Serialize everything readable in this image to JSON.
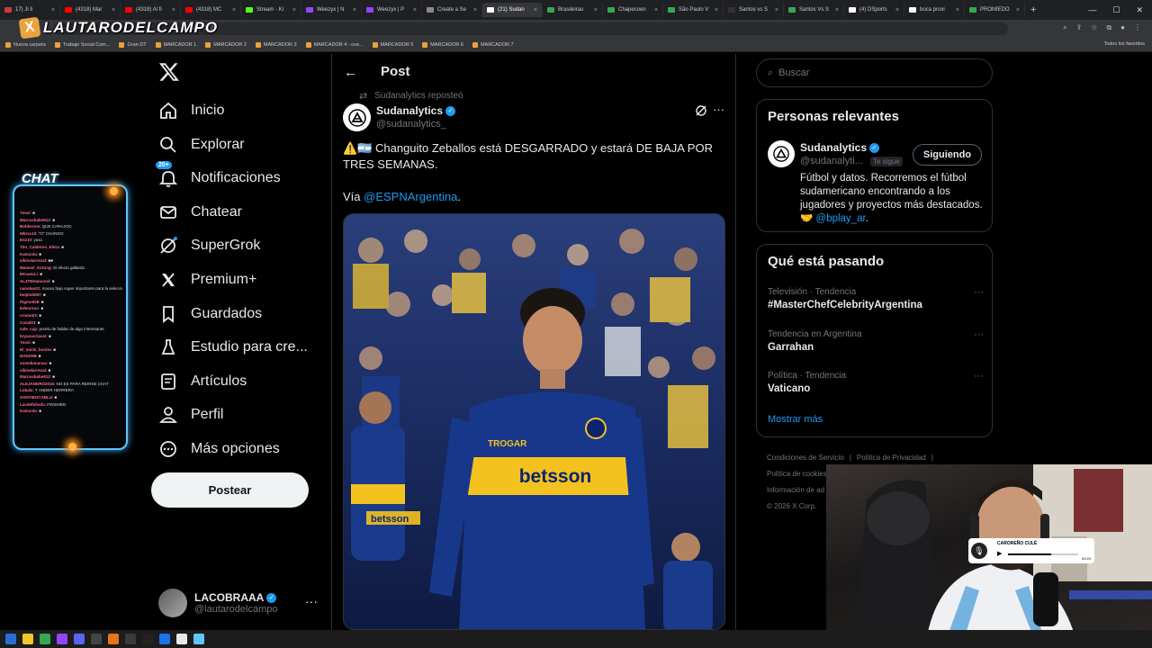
{
  "browser": {
    "tabs": [
      {
        "title": "17) Ji li",
        "color": "#c83c3c"
      },
      {
        "title": "(4318) Mar",
        "color": "#ff0000"
      },
      {
        "title": "(4318) Al fi",
        "color": "#ff0000"
      },
      {
        "title": "(4318) MC",
        "color": "#ff0000"
      },
      {
        "title": "Stream - Ki",
        "color": "#53fc18"
      },
      {
        "title": "Weezyx | N",
        "color": "#9146ff"
      },
      {
        "title": "Weezyx | P",
        "color": "#9146ff"
      },
      {
        "title": "Create a Se",
        "color": "#888888"
      },
      {
        "title": "(21) Sudan",
        "color": "#ffffff",
        "active": true
      },
      {
        "title": "Brasileirao",
        "color": "#34a853"
      },
      {
        "title": "Chapecoen",
        "color": "#34a853"
      },
      {
        "title": "São Paulo V",
        "color": "#34a853"
      },
      {
        "title": "Santos vs S",
        "color": "#333333"
      },
      {
        "title": "Santos Vs S",
        "color": "#34a853"
      },
      {
        "title": "(4) DSports",
        "color": "#ffffff"
      },
      {
        "title": "boca proxi",
        "color": "#ffffff"
      },
      {
        "title": "PROMIEDO",
        "color": "#34a853"
      }
    ],
    "new_tab": "+",
    "window_controls": [
      "—",
      "☐",
      "✕"
    ],
    "address_fragment": "2973672",
    "bookmarks": [
      "Nueva carpeta",
      "Trabajo Social Com...",
      "Gran DT",
      "MARCADOR 1",
      "MARCADOR 2",
      "MARCADOR 3",
      "MARCADOR 4 - ove...",
      "MARCADOR 5",
      "MARCADOR 6",
      "MARCADOR 7"
    ],
    "all_bookmarks": "Todos los favoritos"
  },
  "overlay": {
    "streamer_logo": "LAUTARODELCAMPO",
    "chat_title": "CHAT",
    "chat_lines": [
      {
        "user": "Yossi",
        "msg": ": ■"
      },
      {
        "user": "Marcosbabe912",
        "msg": ": ■"
      },
      {
        "user": "Bolderone",
        "msg": ": QUE CARAJOO"
      },
      {
        "user": "Mbrxc10",
        "msg": ": \"O\" CHANGO"
      },
      {
        "user": "Enz10",
        "msg": ": yoso"
      },
      {
        "user": "Tito_Calderon_Elera",
        "msg": ": ■"
      },
      {
        "user": "Kamcola",
        "msg": ": ■"
      },
      {
        "user": "vikinelarrenal",
        "msg": ": ■■"
      },
      {
        "user": "Mamsel_013ong",
        "msg": ": El efecto gallardo"
      },
      {
        "user": "EKnatoLi",
        "msg": ": ■"
      },
      {
        "user": "AL4TEHamonel",
        "msg": ": ■"
      },
      {
        "user": "nanolao01",
        "msg": ": mooso bajo super importante para la seleccion cabro"
      },
      {
        "user": "beqito0097",
        "msg": ": ■"
      },
      {
        "user": "Pigmo028",
        "msg": ": ■"
      },
      {
        "user": "Edenrnoo",
        "msg": ": ■"
      },
      {
        "user": "cromo03",
        "msg": ": ■"
      },
      {
        "user": "Canal03",
        "msg": ": ■"
      },
      {
        "user": "sale_cap",
        "msg": ": porelo de hablar de algo interesante"
      },
      {
        "user": "bryanuvriaset",
        "msg": ": ■"
      },
      {
        "user": "Yossi",
        "msg": ": ■"
      },
      {
        "user": "El_michi_bonito",
        "msg": ": ■"
      },
      {
        "user": "NANO98",
        "msg": ": ■"
      },
      {
        "user": "somebananas",
        "msg": ": ■"
      },
      {
        "user": "vikinelarrenal",
        "msg": ": ■"
      },
      {
        "user": "Marcosbabe912",
        "msg": ": ■"
      },
      {
        "user": "ALEJANDRO2015",
        "msg": ": NO ES PARA REIRSE CHAT"
      },
      {
        "user": "Lobalx",
        "msg": ": Y ANDER HERRERA"
      },
      {
        "user": "SANTIBOCABLU",
        "msg": ": ■"
      },
      {
        "user": "Lacdefuhsda",
        "msg": ": FINISHED"
      },
      {
        "user": "Kamcola",
        "msg": ": ■"
      }
    ],
    "music_title": "CAROREÑO CULÉ",
    "music_progress": 0.62,
    "music_time": "00:20"
  },
  "nav": {
    "items": [
      {
        "label": "Inicio",
        "icon": "home-icon"
      },
      {
        "label": "Explorar",
        "icon": "search-icon"
      },
      {
        "label": "Notificaciones",
        "icon": "bell-icon",
        "badge": "20+"
      },
      {
        "label": "Chatear",
        "icon": "mail-icon"
      },
      {
        "label": "SuperGrok",
        "icon": "grok-icon"
      },
      {
        "label": "Premium+",
        "icon": "x-premium-icon"
      },
      {
        "label": "Guardados",
        "icon": "bookmark-icon"
      },
      {
        "label": "Estudio para cre...",
        "icon": "flask-icon"
      },
      {
        "label": "Artículos",
        "icon": "article-icon"
      },
      {
        "label": "Perfil",
        "icon": "person-icon"
      },
      {
        "label": "Más opciones",
        "icon": "more-circle-icon"
      }
    ],
    "post_button": "Postear",
    "account": {
      "name": "LACOBRAAA",
      "handle": "@lautarodelcampo"
    }
  },
  "post": {
    "header": "Post",
    "reposted_by": "Sudanalytics reposteó",
    "author_name": "Sudanalytics",
    "author_handle": "@sudanalytics_",
    "text": "⚠️🇦🇷 Changuito Zeballos está DESGARRADO y estará DE BAJA POR TRES SEMANAS.",
    "via_prefix": "Vía ",
    "via_link": "@ESPNArgentina",
    "via_suffix": ".",
    "image_sponsor": "betsson",
    "image_sponsor2": "TROGAR"
  },
  "right": {
    "search_placeholder": "Buscar",
    "relevant_title": "Personas relevantes",
    "relevant": {
      "name": "Sudanalytics",
      "handle": "@sudanalyti...",
      "follows_you": "Te sigue",
      "button": "Siguiendo",
      "bio": "Fútbol y datos. Recorremos el fútbol sudamericano encontrando a los jugadores y proyectos más destacados. 🤝 ",
      "bio_link": "@bplay_ar",
      "bio_end": "."
    },
    "trends_title": "Qué está pasando",
    "trends": [
      {
        "context": "Televisión · Tendencia",
        "name": "#MasterChefCelebrityArgentina"
      },
      {
        "context": "Tendencia en Argentina",
        "name": "Garrahan"
      },
      {
        "context": "Política · Tendencia",
        "name": "Vaticano"
      }
    ],
    "show_more": "Mostrar más",
    "footer": [
      "Condiciones de Servicio",
      "|",
      "Política de Privacidad",
      "|",
      "Política de cookies",
      "Información de ad",
      "© 2026 X Corp."
    ]
  },
  "colors": {
    "accent": "#1d9bf0",
    "background": "#000000",
    "border": "#2f3336",
    "chat_border": "#5ec7ff"
  }
}
